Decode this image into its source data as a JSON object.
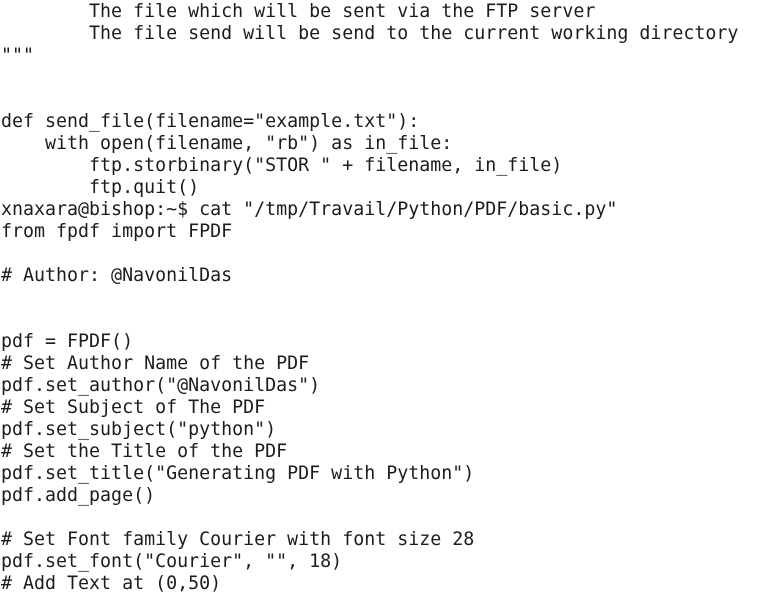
{
  "terminal": {
    "lines": [
      "        The file which will be sent via the FTP server",
      "        The file send will be send to the current working directory",
      "\"\"\"",
      "",
      "",
      "def send_file(filename=\"example.txt\"):",
      "    with open(filename, \"rb\") as in_file:",
      "        ftp.storbinary(\"STOR \" + filename, in_file)",
      "        ftp.quit()",
      "xnaxara@bishop:~$ cat \"/tmp/Travail/Python/PDF/basic.py\"",
      "from fpdf import FPDF",
      "",
      "# Author: @NavonilDas",
      "",
      "",
      "pdf = FPDF()",
      "# Set Author Name of the PDF",
      "pdf.set_author(\"@NavonilDas\")",
      "# Set Subject of The PDF",
      "pdf.set_subject(\"python\")",
      "# Set the Title of the PDF",
      "pdf.set_title(\"Generating PDF with Python\")",
      "pdf.add_page()",
      "",
      "# Set Font family Courier with font size 28",
      "pdf.set_font(\"Courier\", \"\", 18)",
      "# Add Text at (0,50)"
    ]
  }
}
